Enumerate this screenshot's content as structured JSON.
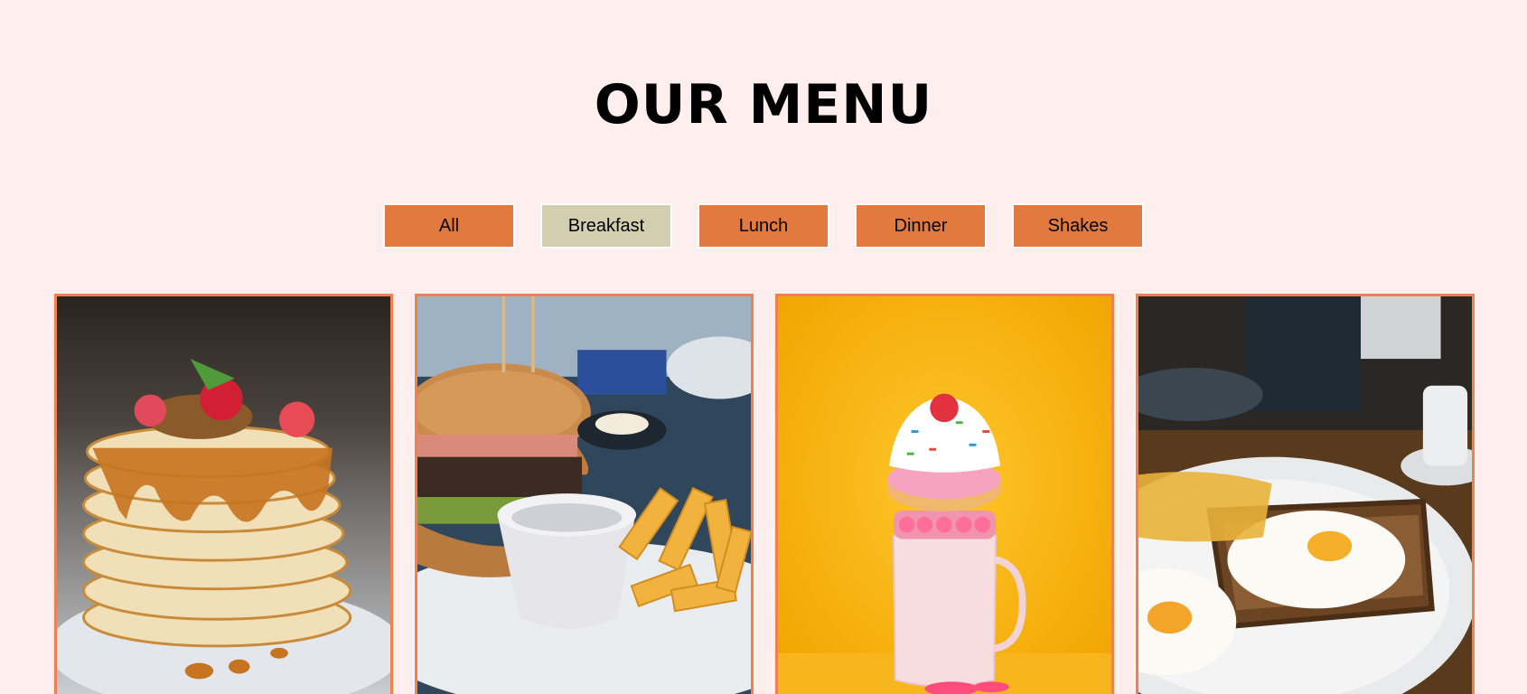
{
  "menu": {
    "title": "OUR MENU"
  },
  "filters": [
    {
      "label": "All",
      "active": false
    },
    {
      "label": "Breakfast",
      "active": true
    },
    {
      "label": "Lunch",
      "active": false
    },
    {
      "label": "Dinner",
      "active": false
    },
    {
      "label": "Shakes",
      "active": false
    }
  ],
  "colors": {
    "background": "#ffeeee",
    "button": "#e2793e",
    "button_active": "#d2ceae",
    "card_border": "#f0804e"
  },
  "items": [
    {
      "image": "pancakes-photo"
    },
    {
      "image": "burger-fries-photo"
    },
    {
      "image": "milkshake-photo"
    },
    {
      "image": "eggs-toast-photo"
    }
  ]
}
